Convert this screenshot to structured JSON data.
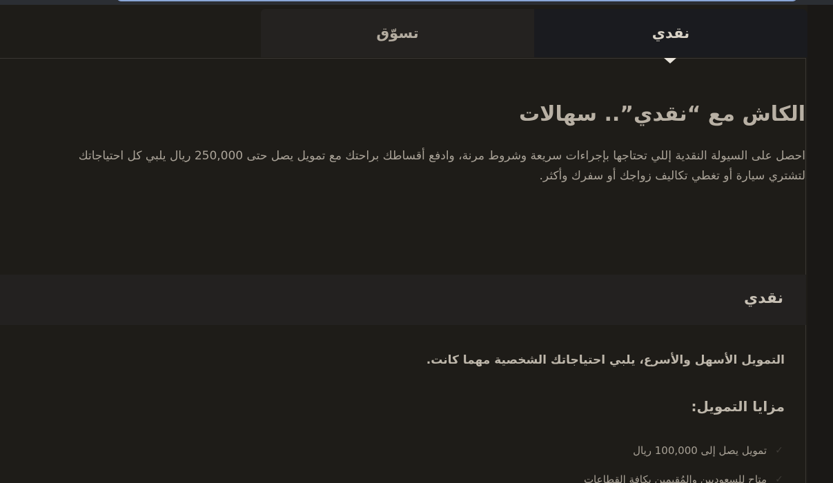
{
  "tabs": [
    {
      "label": "نقدي",
      "active": true
    },
    {
      "label": "تسوّق",
      "active": false
    }
  ],
  "hero": {
    "title": "الكاش مع “نقدي”.. سهالات",
    "description_line1": "احصل على السيولة النقدية إللي تحتاجها بإجراءات سريعة وشروط مرنة، وادفع أقساطك براحتك مع تمويل يصل حتى 250,000 ريال يلبي كل احتياجاتك",
    "description_line2": "لتشتري سيارة أو تغطي تكاليف زواجك أو سفرك وأكثر."
  },
  "section": {
    "title": "نقدي",
    "lead": "التمويل الأسهل والأسرع، يلبي احتياجاتك الشخصية مهما كانت.",
    "benefits_title": "مزايا التمويل:",
    "benefits": [
      "تمويل يصل إلى 100,000 ريال",
      "متاح للسعوديين والمُقيمين بكافة القطاعات"
    ]
  },
  "icons": {
    "check": "check-icon",
    "tab_indicator": "caret-down-icon"
  },
  "colors": {
    "background": "#1e1c18",
    "active_tab": "#1a1b1f",
    "inactive_tab": "#242220",
    "section_bar": "#232120",
    "text": "#b8b0a4"
  }
}
